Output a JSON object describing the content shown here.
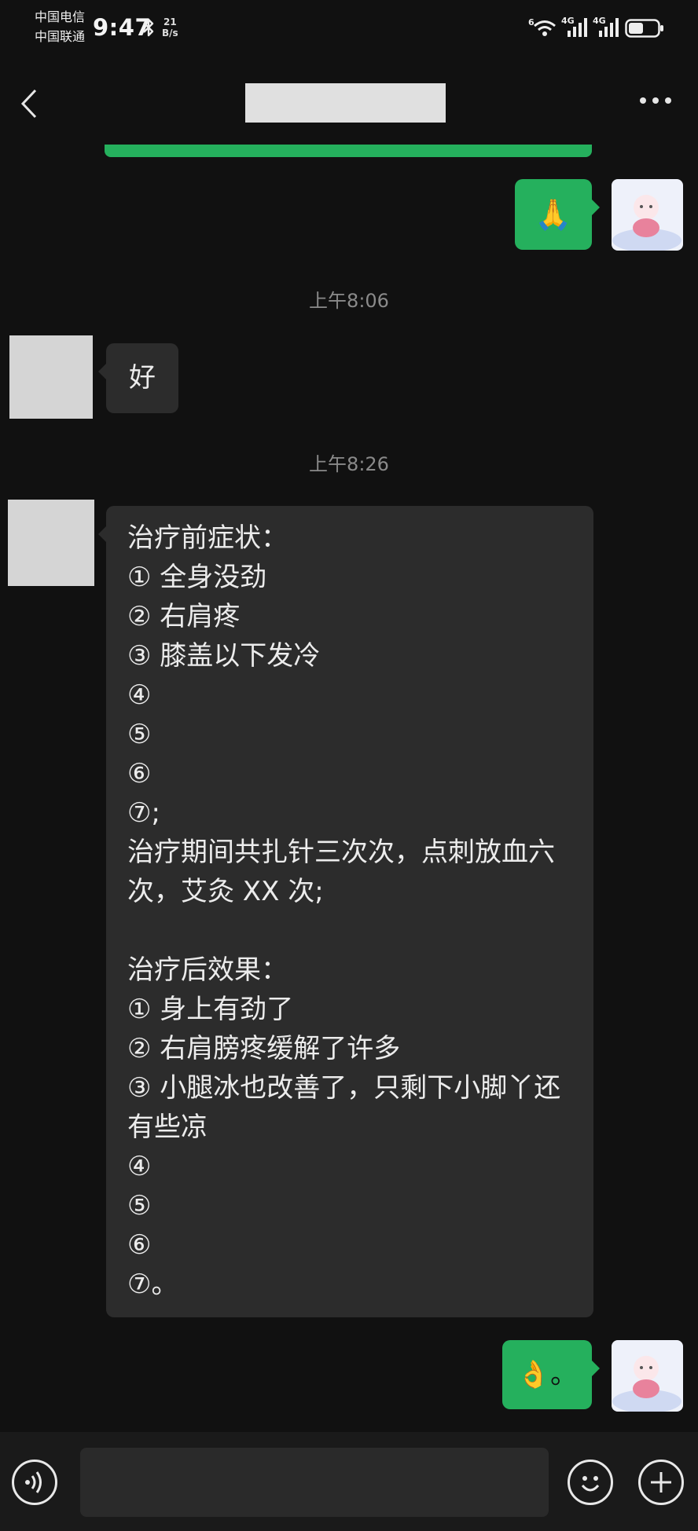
{
  "status_bar": {
    "carrier_1": "中国电信",
    "carrier_2": "中国联通",
    "time": "9:47",
    "net_speed_value": "21",
    "net_speed_unit": "B/s",
    "wifi_badge": "6",
    "sim1_label": "4G",
    "sim2_label": "4G",
    "icons": [
      "bluetooth-icon",
      "wifi-icon",
      "signal-icon",
      "battery-icon"
    ]
  },
  "header": {
    "icons": [
      "back-arrow-icon",
      "more-icon"
    ]
  },
  "messages": [
    {
      "type": "outgoing",
      "emoji": "🙏"
    },
    {
      "type": "timestamp",
      "text": "上午8:06"
    },
    {
      "type": "incoming",
      "text": "好"
    },
    {
      "type": "timestamp",
      "text": "上午8:26"
    },
    {
      "type": "incoming",
      "text": "治疗前症状：\n① 全身没劲\n② 右肩疼\n③ 膝盖以下发冷\n④\n⑤\n⑥\n⑦;\n治疗期间共扎针三次次，点刺放血六次，艾灸 XX 次;\n\n治疗后效果：\n① 身上有劲了\n② 右肩膀疼缓解了许多\n③ 小腿冰也改善了，只剩下小脚丫还有些凉\n④\n⑤\n⑥\n⑦。"
    },
    {
      "type": "outgoing",
      "text": "👌。"
    }
  ],
  "input_bar": {
    "icons": [
      "voice-icon",
      "emoji-icon",
      "plus-icon"
    ]
  },
  "colors": {
    "background": "#111111",
    "outgoing_bubble": "#25b05d",
    "incoming_bubble": "#2c2c2c",
    "timestamp": "#8a8a8a"
  }
}
